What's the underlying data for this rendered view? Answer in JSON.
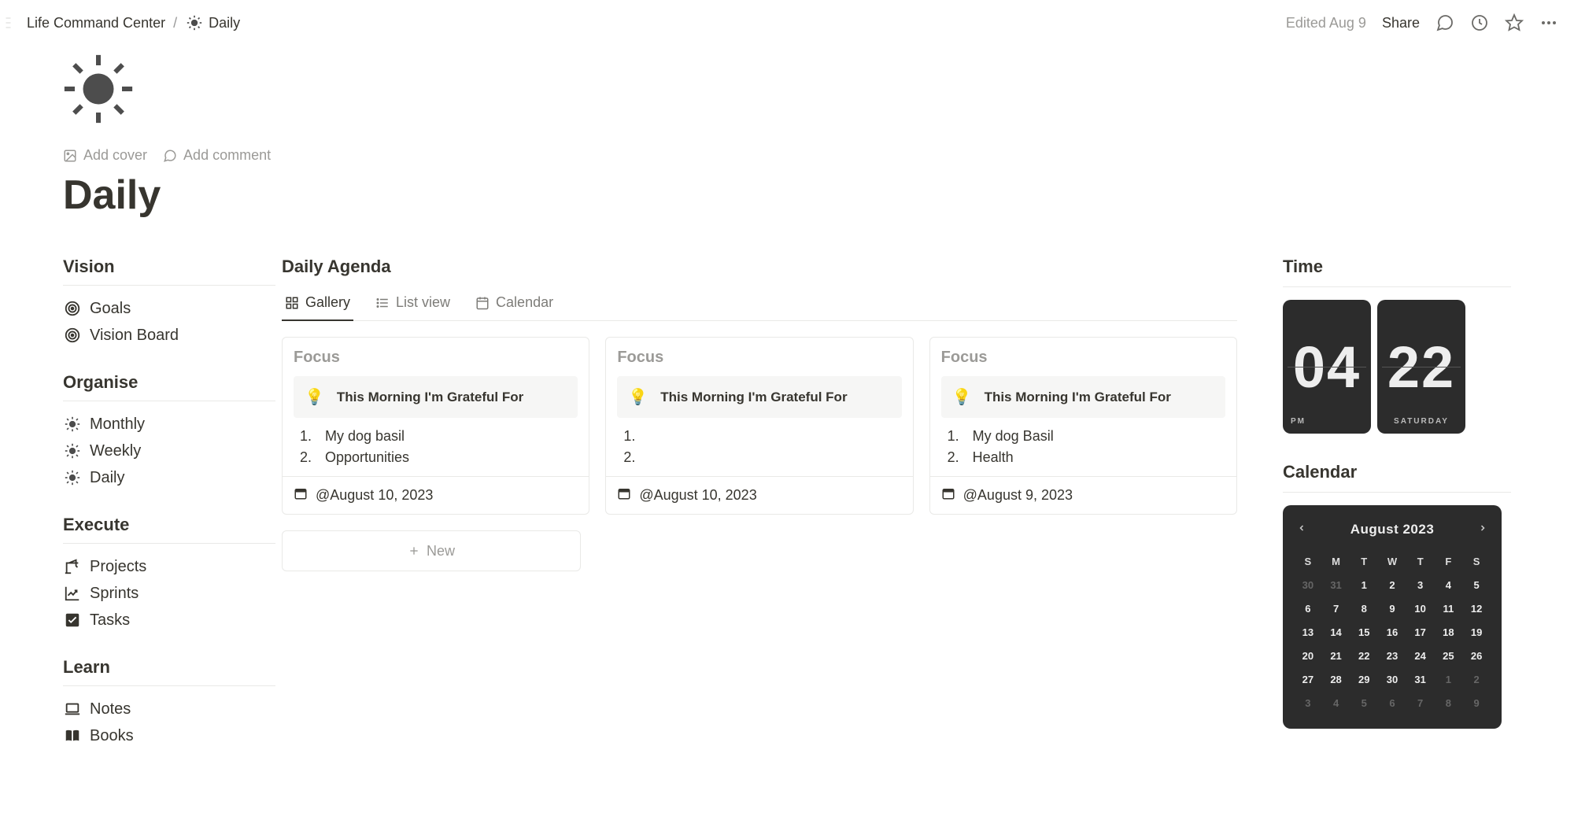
{
  "breadcrumb": {
    "parent": "Life Command Center",
    "current": "Daily"
  },
  "topbar": {
    "edited": "Edited Aug 9",
    "share": "Share"
  },
  "hero": {
    "add_cover": "Add cover",
    "add_comment": "Add comment"
  },
  "page_title": "Daily",
  "nav": {
    "vision": {
      "title": "Vision",
      "items": [
        "Goals",
        "Vision Board"
      ]
    },
    "organise": {
      "title": "Organise",
      "items": [
        "Monthly",
        "Weekly",
        "Daily"
      ]
    },
    "execute": {
      "title": "Execute",
      "items": [
        "Projects",
        "Sprints",
        "Tasks"
      ]
    },
    "learn": {
      "title": "Learn",
      "items": [
        "Notes",
        "Books"
      ]
    }
  },
  "agenda": {
    "title": "Daily Agenda",
    "tabs": [
      "Gallery",
      "List view",
      "Calendar"
    ],
    "cards": [
      {
        "focus": "Focus",
        "callout": "This Morning I'm Grateful For",
        "items": [
          "My dog basil",
          "Opportunities"
        ],
        "date": "@August 10, 2023"
      },
      {
        "focus": "Focus",
        "callout": "This Morning I'm Grateful For",
        "items": [
          "",
          ""
        ],
        "date": "@August 10, 2023"
      },
      {
        "focus": "Focus",
        "callout": "This Morning I'm Grateful For",
        "items": [
          "My dog Basil",
          "Health"
        ],
        "date": "@August 9, 2023"
      }
    ],
    "new_label": "New"
  },
  "time": {
    "title": "Time",
    "hour": "04",
    "minute": "22",
    "ampm": "PM",
    "dow": "SATURDAY"
  },
  "calendar": {
    "title": "Calendar",
    "month": "August 2023",
    "dows": [
      "S",
      "M",
      "T",
      "W",
      "T",
      "F",
      "S"
    ],
    "rows": [
      [
        {
          "d": "30",
          "off": true
        },
        {
          "d": "31",
          "off": true
        },
        {
          "d": "1"
        },
        {
          "d": "2"
        },
        {
          "d": "3"
        },
        {
          "d": "4"
        },
        {
          "d": "5"
        }
      ],
      [
        {
          "d": "6"
        },
        {
          "d": "7"
        },
        {
          "d": "8"
        },
        {
          "d": "9"
        },
        {
          "d": "10"
        },
        {
          "d": "11"
        },
        {
          "d": "12"
        }
      ],
      [
        {
          "d": "13"
        },
        {
          "d": "14"
        },
        {
          "d": "15"
        },
        {
          "d": "16"
        },
        {
          "d": "17"
        },
        {
          "d": "18"
        },
        {
          "d": "19"
        }
      ],
      [
        {
          "d": "20"
        },
        {
          "d": "21"
        },
        {
          "d": "22"
        },
        {
          "d": "23"
        },
        {
          "d": "24"
        },
        {
          "d": "25"
        },
        {
          "d": "26"
        }
      ],
      [
        {
          "d": "27"
        },
        {
          "d": "28"
        },
        {
          "d": "29"
        },
        {
          "d": "30"
        },
        {
          "d": "31"
        },
        {
          "d": "1",
          "off": true
        },
        {
          "d": "2",
          "off": true
        }
      ],
      [
        {
          "d": "3",
          "off": true
        },
        {
          "d": "4",
          "off": true
        },
        {
          "d": "5",
          "off": true
        },
        {
          "d": "6",
          "off": true
        },
        {
          "d": "7",
          "off": true
        },
        {
          "d": "8",
          "off": true
        },
        {
          "d": "9",
          "off": true
        }
      ]
    ]
  }
}
